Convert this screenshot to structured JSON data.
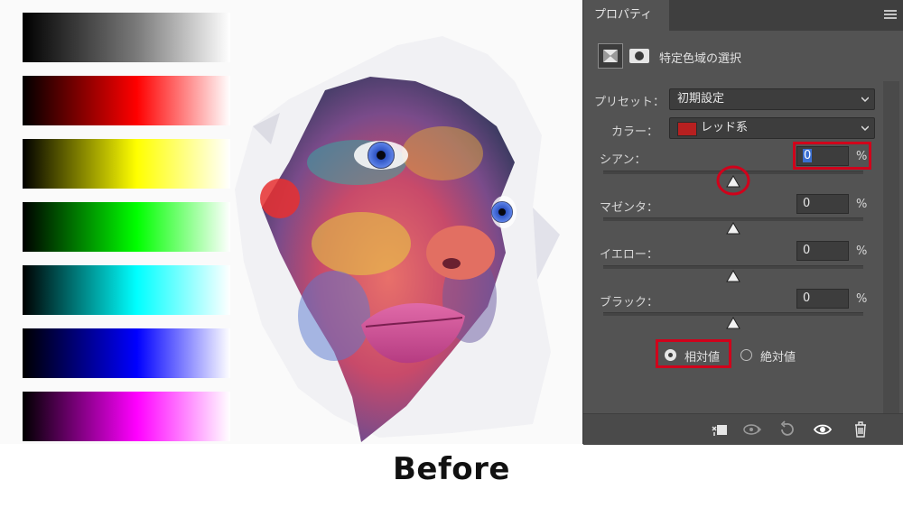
{
  "panel": {
    "tab_title": "プロパティ",
    "header_title": "特定色域の選択",
    "preset_label": "プリセット：",
    "preset_value": "初期設定",
    "color_label": "カラー：",
    "color_value": "レッド系",
    "color_swatch": "#b72020",
    "sliders": [
      {
        "label": "シアン：",
        "value": "0",
        "unit": "%"
      },
      {
        "label": "マゼンタ：",
        "value": "0",
        "unit": "%"
      },
      {
        "label": "イエロー：",
        "value": "0",
        "unit": "%"
      },
      {
        "label": "ブラック：",
        "value": "0",
        "unit": "%"
      }
    ],
    "mode_relative": "相対値",
    "mode_absolute": "絶対値",
    "selected_mode": "相対値",
    "footer_icons": [
      "clip-to-layer-icon",
      "view-previous-state-icon",
      "reset-icon",
      "visibility-eye-icon",
      "trash-icon"
    ]
  },
  "caption": "Before",
  "highlight_color": "#d0021b"
}
